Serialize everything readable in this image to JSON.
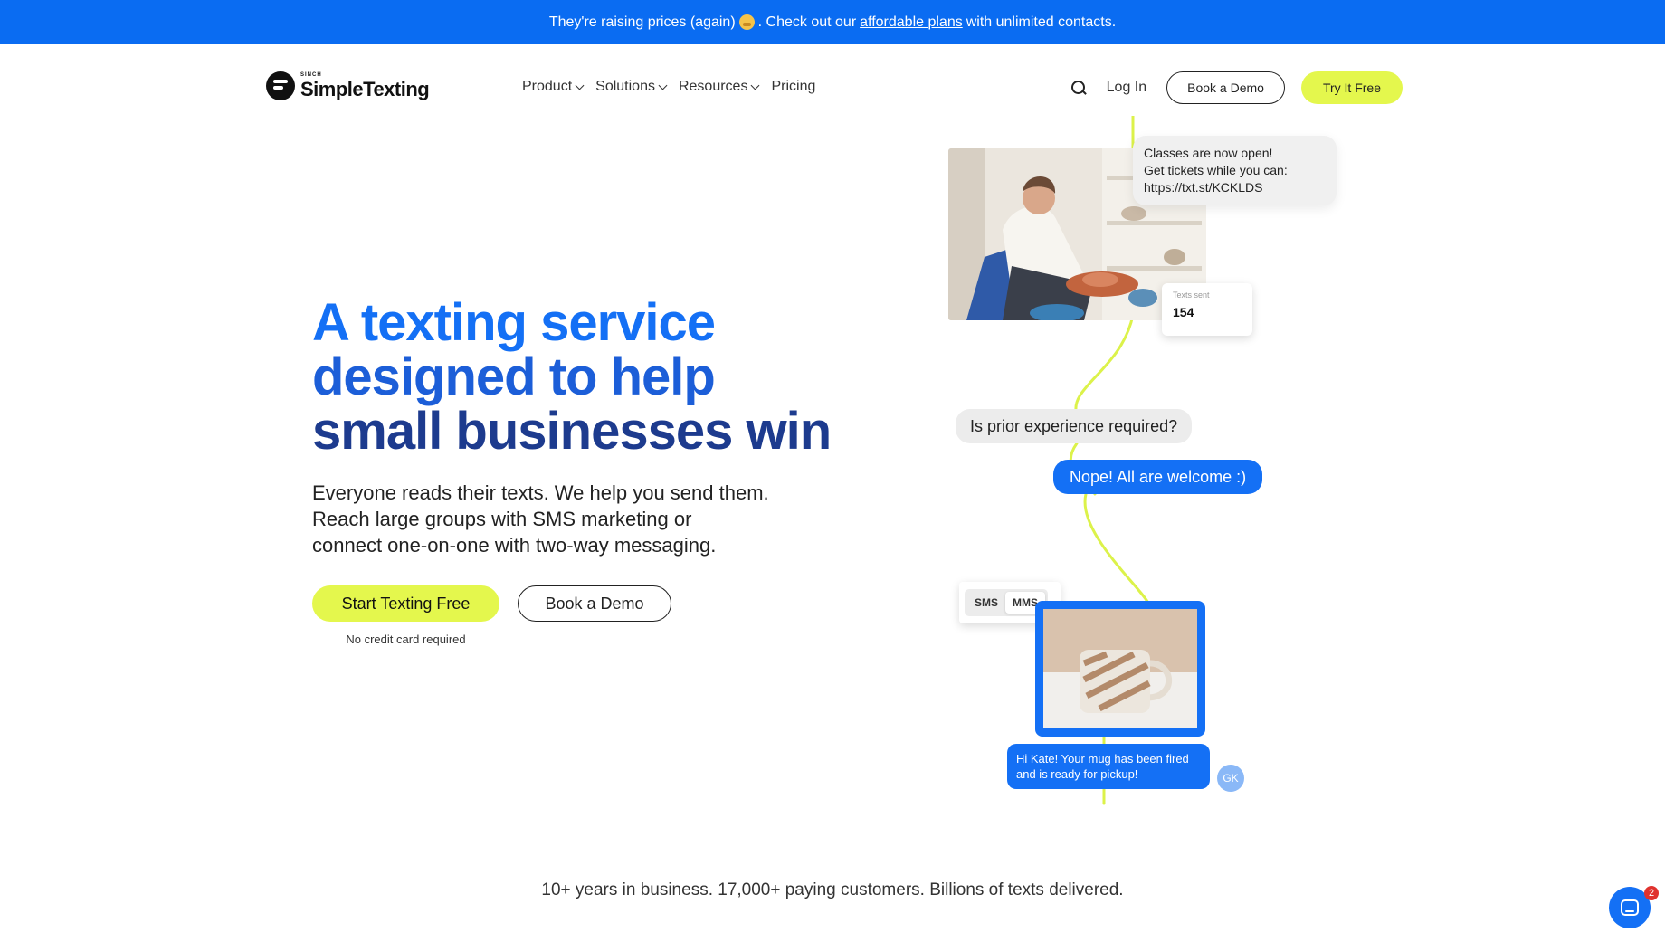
{
  "announcement": {
    "text_before": "They're raising prices (again)",
    "text_middle": ". Check out our",
    "link": "affordable plans",
    "text_after": "with unlimited contacts."
  },
  "nav": {
    "logo_sub": "SINCH",
    "logo_name": "SimpleTexting",
    "menu": [
      {
        "label": "Product"
      },
      {
        "label": "Solutions"
      },
      {
        "label": "Resources"
      },
      {
        "label": "Pricing"
      }
    ],
    "login": "Log In",
    "book_demo": "Book a Demo",
    "try_free": "Try It Free"
  },
  "hero": {
    "title_lines": [
      "A texting service",
      "designed to help",
      "small businesses win"
    ],
    "subtitle_lines": [
      "Everyone reads their texts. We help you send them.",
      "Reach large groups with SMS marketing or",
      "connect one-on-one with two-way messaging."
    ],
    "cta_primary": "Start Texting Free",
    "cta_secondary": "Book a Demo",
    "note": "No credit card required"
  },
  "illustration": {
    "message1_lines": [
      "Classes are now open!",
      "Get tickets while you can:",
      "https://txt.st/KCKLDS"
    ],
    "texts_sent_label": "Texts sent",
    "texts_sent_value": "154",
    "question": "Is prior experience required?",
    "answer": "Nope! All are welcome :)",
    "toggle": [
      "SMS",
      "MMS"
    ],
    "message2_lines": [
      "Hi Kate! Your mug has been fired",
      "and is ready for pickup!"
    ],
    "avatar_initials": "GK"
  },
  "stats": "10+ years in business. 17,000+ paying customers. Billions of texts delivered.",
  "chat_widget": {
    "badge": "2"
  },
  "colors": {
    "brand_blue": "#1470f5",
    "lime": "#e4f74d",
    "navy": "#1d3b8e"
  }
}
